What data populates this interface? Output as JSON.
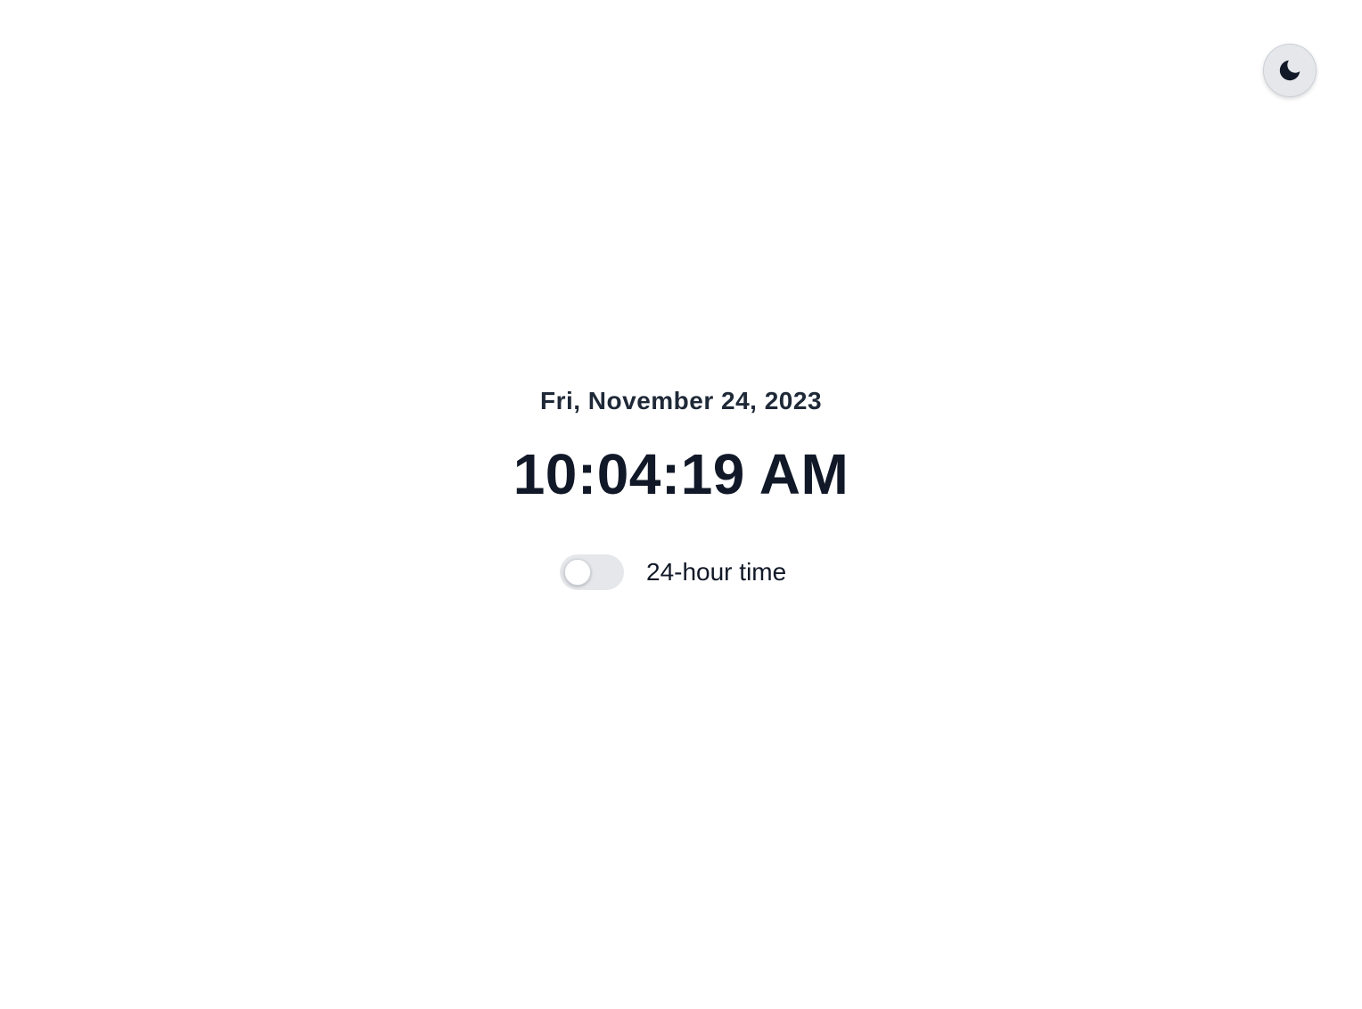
{
  "header": {
    "theme_toggle": {
      "icon": "moon-icon",
      "mode": "light"
    }
  },
  "clock": {
    "date": "Fri, November 24, 2023",
    "time": "10:04:19 AM"
  },
  "settings": {
    "hour24_label": "24-hour time",
    "hour24_enabled": false
  },
  "colors": {
    "text": "#111827",
    "toggle_track_off": "#e5e7eb",
    "theme_button_bg": "#e5e7eb",
    "background": "#ffffff"
  }
}
